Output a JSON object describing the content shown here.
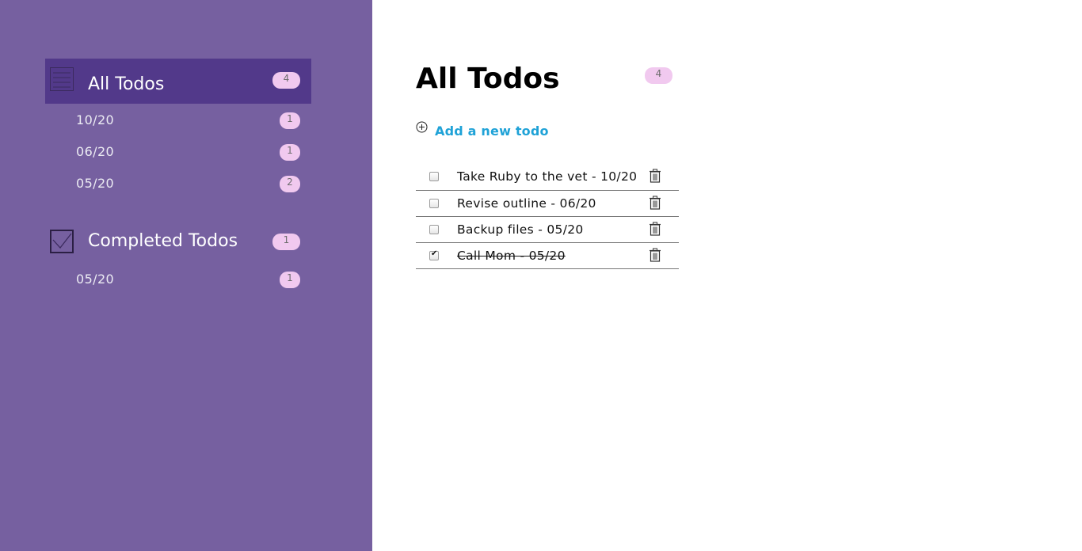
{
  "sidebar": {
    "all": {
      "label": "All Todos",
      "count": "4",
      "icon": "list-icon",
      "groups": [
        {
          "label": "10/20",
          "count": "1"
        },
        {
          "label": "06/20",
          "count": "1"
        },
        {
          "label": "05/20",
          "count": "2"
        }
      ]
    },
    "completed": {
      "label": "Completed Todos",
      "count": "1",
      "icon": "checkbox-icon",
      "groups": [
        {
          "label": "05/20",
          "count": "1"
        }
      ]
    }
  },
  "main": {
    "title": "All Todos",
    "count": "4",
    "add_label": "Add a new todo",
    "todos": [
      {
        "title": "Take Ruby to the vet - 10/20",
        "completed": false
      },
      {
        "title": "Revise outline - 06/20",
        "completed": false
      },
      {
        "title": "Backup files - 05/20",
        "completed": false
      },
      {
        "title": "Call Mom - 05/20",
        "completed": true
      }
    ]
  },
  "colors": {
    "sidebar_bg": "#7660a0",
    "active_bg": "#52398a",
    "badge_bg": "#f1c9ef",
    "link": "#1fa2d7"
  }
}
